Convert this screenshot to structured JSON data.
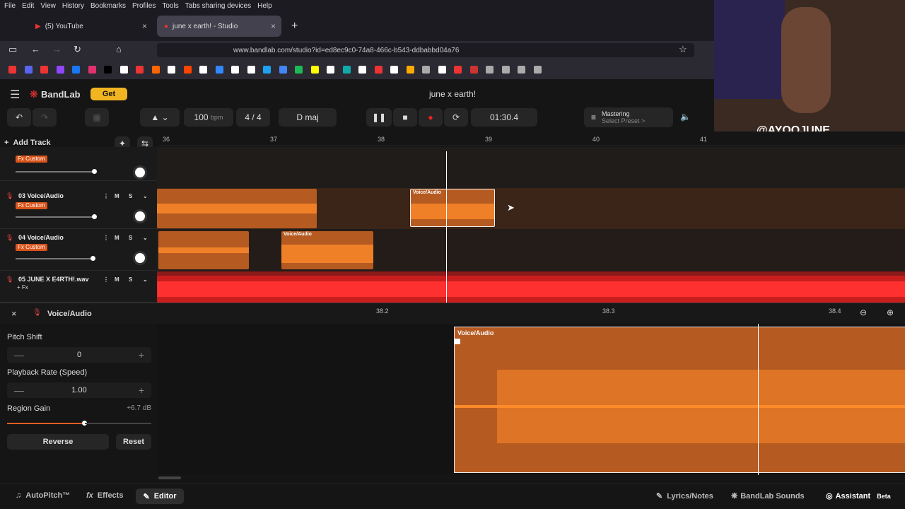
{
  "browser": {
    "menu": [
      "File",
      "Edit",
      "View",
      "History",
      "Bookmarks",
      "Profiles",
      "Tools",
      "Tabs sharing devices",
      "Help"
    ],
    "tabs": [
      {
        "label": "(5) YouTube"
      },
      {
        "label": "june x earth! - Studio"
      }
    ],
    "url": "www.bandlab.com/studio?id=ed8ec9c0-74a8-466c-b543-ddbabbd04a76"
  },
  "app": {
    "brand": "BandLab",
    "get_label": "Get",
    "project_title": "june x earth!",
    "bpm_value": "100",
    "bpm_unit": "bpm",
    "time_sig": "4 / 4",
    "key": "D maj",
    "time": "01:30.4",
    "mastering_label": "Mastering",
    "mastering_sub": "Select Preset >",
    "add_track": "Add Track",
    "watermark": "@AYOOJUNE"
  },
  "ruler": [
    "36",
    "37",
    "38",
    "39",
    "40",
    "41"
  ],
  "tracks": [
    {
      "name": "",
      "fx": "Fx Custom"
    },
    {
      "name": "03 Voice/Audio",
      "fx": "Fx Custom",
      "m": "M",
      "s": "S"
    },
    {
      "name": "04 Voice/Audio",
      "fx": "Fx Custom",
      "m": "M",
      "s": "S"
    },
    {
      "name": "05 JUNE X E4RTH!.wav",
      "fx": "+ Fx",
      "m": "M",
      "s": "S"
    }
  ],
  "region_label": "Voice/Audio",
  "editor": {
    "title": "Voice/Audio",
    "ruler": [
      "38.2",
      "38.3",
      "38.4"
    ],
    "pitch_shift_label": "Pitch Shift",
    "pitch_shift_value": "0",
    "playback_label": "Playback Rate (Speed)",
    "playback_value": "1.00",
    "gain_label": "Region Gain",
    "gain_value": "+6.7 dB",
    "reverse": "Reverse",
    "reset": "Reset",
    "minus": "—",
    "plus": "+"
  },
  "bottom": {
    "autopitch": "AutoPitch™",
    "effects": "Effects",
    "editor": "Editor",
    "lyrics": "Lyrics/Notes",
    "sounds": "BandLab Sounds",
    "assistant": "Assistant",
    "beta": "Beta"
  }
}
